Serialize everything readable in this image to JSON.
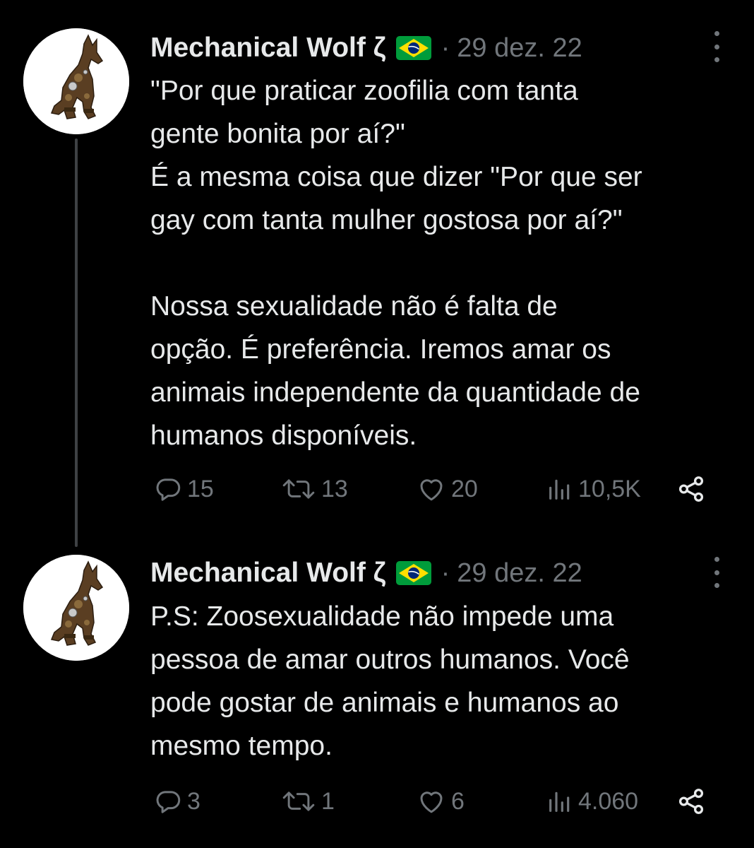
{
  "tweets": [
    {
      "author": "Mechanical Wolf ζ",
      "flag": "brazil-flag",
      "separator": "·",
      "date": "29 dez. 22",
      "text": "\"Por que praticar zoofilia com tanta\ngente bonita por aí?\"\nÉ a mesma coisa que dizer \"Por que ser\ngay com tanta mulher gostosa por aí?\"\n\nNossa sexualidade não é falta de\nopção. É preferência. Iremos amar os\nanimais independente da quantidade de\nhumanos disponíveis.",
      "replies": "15",
      "retweets": "13",
      "likes": "20",
      "views": "10,5K"
    },
    {
      "author": "Mechanical Wolf ζ",
      "flag": "brazil-flag",
      "separator": "·",
      "date": "29 dez. 22",
      "text": "P.S: Zoosexualidade não impede uma\npessoa de amar outros humanos. Você\npode gostar de animais e humanos ao\nmesmo tempo.",
      "replies": "3",
      "retweets": "1",
      "likes": "6",
      "views": "4.060"
    }
  ],
  "colors": {
    "background": "#000000",
    "text_primary": "#e7e9ea",
    "text_secondary": "#71767b",
    "thread_line": "#3e4144"
  }
}
